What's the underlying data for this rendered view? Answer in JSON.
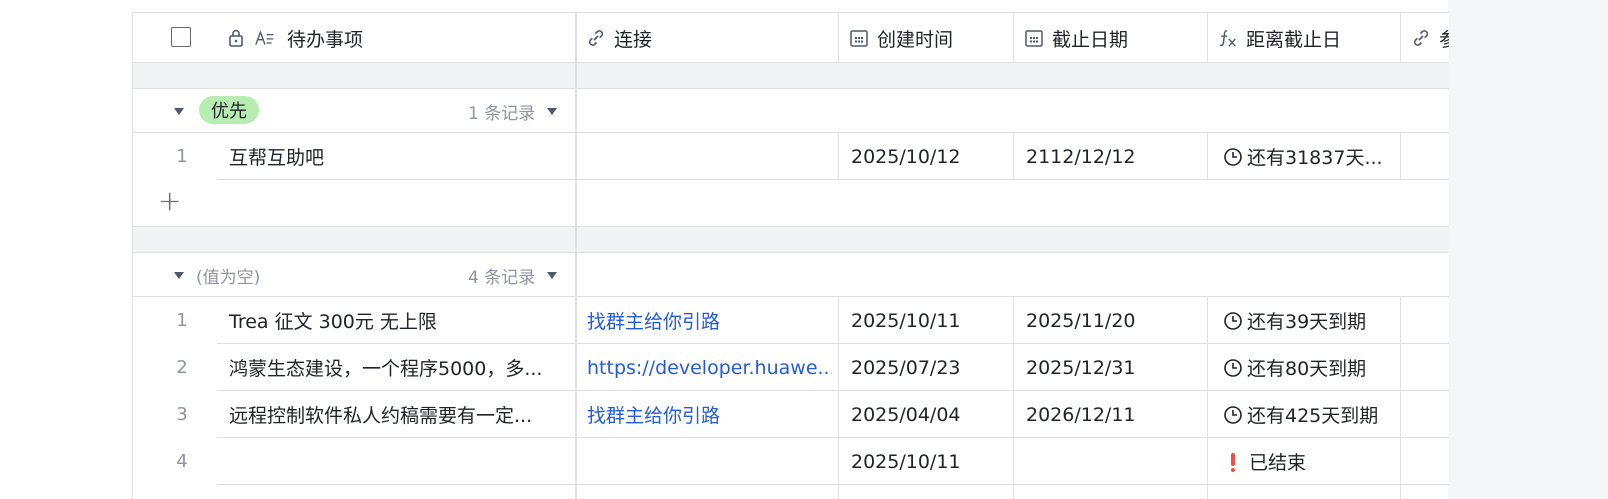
{
  "header": {
    "columns": [
      {
        "icon": "lock-icon",
        "icon2": "text-field-icon",
        "label": "待办事项"
      },
      {
        "icon": "link-icon",
        "label": "连接"
      },
      {
        "icon": "calendar-icon",
        "label": "创建时间"
      },
      {
        "icon": "calendar-icon",
        "label": "截止日期"
      },
      {
        "icon": "formula-icon",
        "label": "距离截止日"
      },
      {
        "icon": "link-icon",
        "label": "参"
      }
    ]
  },
  "groups": [
    {
      "tag": "优先",
      "count_label": "1 条记录",
      "rows": [
        {
          "num": "1",
          "title": "互帮互助吧",
          "link": "",
          "created": "2025/10/12",
          "due": "2112/12/12",
          "status": "还有31837天...",
          "status_icon": "clock-icon"
        }
      ]
    },
    {
      "tag": "(值为空)",
      "count_label": "4 条记录",
      "rows": [
        {
          "num": "1",
          "title": "Trea 征文 300元 无上限",
          "link": "找群主给你引路",
          "created": "2025/10/11",
          "due": "2025/11/20",
          "status": "还有39天到期",
          "status_icon": "clock-icon"
        },
        {
          "num": "2",
          "title": "鸿蒙生态建设，一个程序5000，多...",
          "link": "https://developer.huawe...",
          "created": "2025/07/23",
          "due": "2025/12/31",
          "status": "还有80天到期",
          "status_icon": "clock-icon"
        },
        {
          "num": "3",
          "title": "远程控制软件私人约稿需要有一定...",
          "link": "找群主给你引路",
          "created": "2025/04/04",
          "due": "2026/12/11",
          "status": "还有425天到期",
          "status_icon": "clock-icon"
        },
        {
          "num": "4",
          "title": "",
          "link": "",
          "created": "2025/10/11",
          "due": "",
          "status": "已结束",
          "status_icon": "exclamation-icon"
        }
      ]
    }
  ],
  "colors": {
    "accent": "#245bdb",
    "tag_green": "#b7edb1",
    "grid_line": "#dee0e3",
    "band": "#f2f3f5",
    "warning": "#f54a45"
  }
}
